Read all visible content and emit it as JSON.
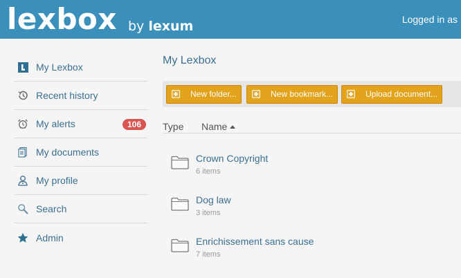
{
  "header": {
    "logo": "lexbox",
    "byline_by": "by",
    "byline_brand": "lexum",
    "logged_in_text": "Logged in as"
  },
  "sidebar": {
    "items": [
      {
        "label": "My Lexbox",
        "icon": "lexbox-l-icon"
      },
      {
        "label": "Recent history",
        "icon": "history-icon"
      },
      {
        "label": "My alerts",
        "icon": "alarm-clock-icon",
        "badge": "106"
      },
      {
        "label": "My documents",
        "icon": "documents-icon"
      },
      {
        "label": "My profile",
        "icon": "profile-icon"
      },
      {
        "label": "Search",
        "icon": "magnifier-icon"
      },
      {
        "label": "Admin",
        "icon": "star-icon"
      }
    ]
  },
  "main": {
    "title": "My Lexbox",
    "toolbar": {
      "new_folder": "New folder...",
      "new_bookmark": "New bookmark...",
      "upload_document": "Upload document..."
    },
    "columns": {
      "type": "Type",
      "name": "Name"
    },
    "rows": [
      {
        "title": "Crown Copyright",
        "meta": "6 items"
      },
      {
        "title": "Dog law",
        "meta": "3 items"
      },
      {
        "title": "Enrichissement sans cause",
        "meta": "7 items"
      }
    ]
  },
  "colors": {
    "header_bg": "#3a8fbb",
    "link": "#3a6f8f",
    "button_bg": "#e2a21c",
    "badge_bg": "#d9534f"
  }
}
